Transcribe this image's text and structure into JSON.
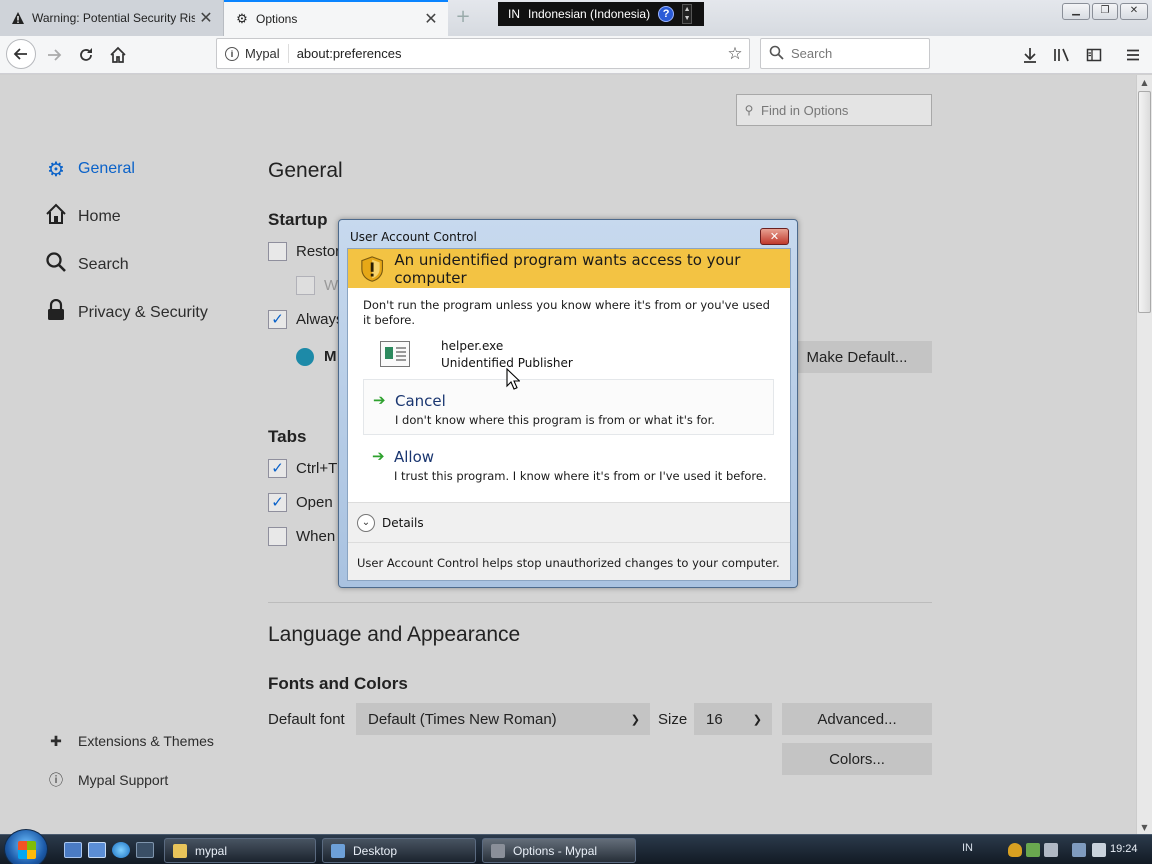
{
  "tabs": [
    {
      "label": "Warning: Potential Security Risk",
      "icon": "warning-icon"
    },
    {
      "label": "Options",
      "icon": "gear-icon"
    }
  ],
  "language_bar": {
    "code": "IN",
    "language": "Indonesian (Indonesia)",
    "help": "?"
  },
  "navbar": {
    "identity_label": "Mypal",
    "url": "about:preferences",
    "search_placeholder": "Search"
  },
  "sidebar": {
    "categories": [
      {
        "label": "General",
        "icon": "gear-icon",
        "active": true
      },
      {
        "label": "Home",
        "icon": "home-icon"
      },
      {
        "label": "Search",
        "icon": "search-icon"
      },
      {
        "label": "Privacy & Security",
        "icon": "lock-icon"
      }
    ],
    "footer": [
      {
        "label": "Extensions & Themes",
        "icon": "puzzle-icon"
      },
      {
        "label": "Mypal Support",
        "icon": "help-icon"
      }
    ]
  },
  "find_options_placeholder": "Find in Options",
  "general": {
    "title": "General",
    "startup": {
      "heading": "Startup",
      "restore_label": "Restore",
      "warn_label": "W",
      "always_label": "Always",
      "default_label": "M",
      "make_default": "Make Default..."
    },
    "tabs": {
      "heading": "Tabs",
      "ctrl_tab_label": "Ctrl+T",
      "open_label": "Open",
      "when_label": "When"
    }
  },
  "language_appearance": {
    "title": "Language and Appearance",
    "fonts": {
      "heading": "Fonts and Colors",
      "default_font_label": "Default font",
      "default_font_value": "Default (Times New Roman)",
      "size_label": "Size",
      "size_value": "16",
      "advanced_button": "Advanced...",
      "colors_button": "Colors..."
    }
  },
  "uac": {
    "title": "User Account Control",
    "banner": "An unidentified program wants access to your computer",
    "warning": "Don't run the program unless you know where it's from or you've used it before.",
    "program_name": "helper.exe",
    "publisher": "Unidentified Publisher",
    "cancel": {
      "label": "Cancel",
      "desc": "I don't know where this program is from or what it's for."
    },
    "allow": {
      "label": "Allow",
      "desc": "I trust this program. I know where it's from or I've used it before."
    },
    "details": "Details",
    "footer": "User Account Control helps stop unauthorized changes to your computer."
  },
  "taskbar": {
    "items": [
      {
        "label": "mypal"
      },
      {
        "label": "Desktop"
      },
      {
        "label": "Options - Mypal"
      }
    ],
    "tray_lang": "IN",
    "clock": "19:24"
  },
  "colors": {
    "accent": "#0a62c9",
    "uac_banner": "#f3c343",
    "taskbar": "#1b2634"
  }
}
